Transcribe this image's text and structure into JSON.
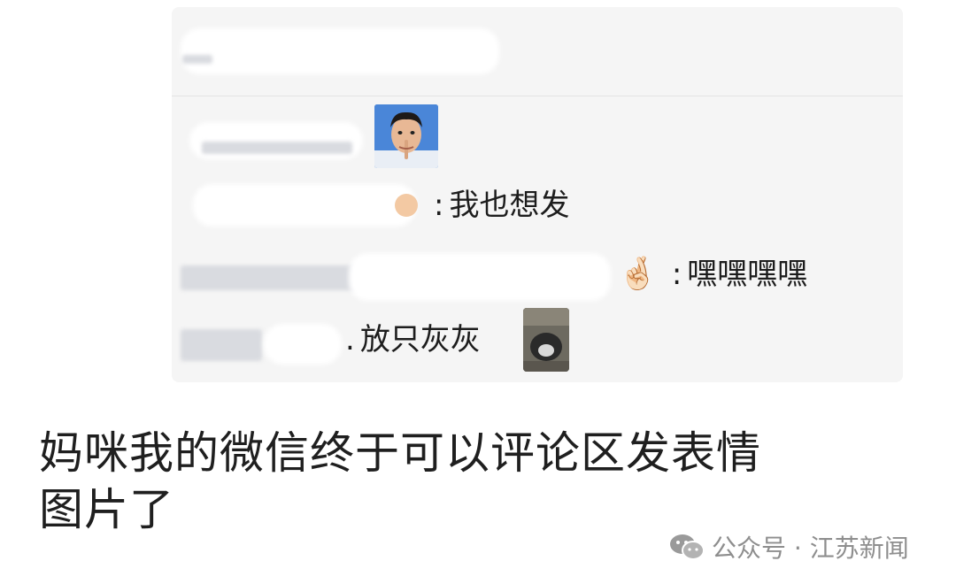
{
  "comments": [
    {
      "separator": "",
      "text": "",
      "sticker": "avatar-sticker"
    },
    {
      "separator": ":",
      "text": "我也想发"
    },
    {
      "separator": ":",
      "text": "嘿嘿嘿嘿",
      "emoji": "🤞🏻"
    },
    {
      "separator": ".",
      "text": "放只灰灰",
      "sticker": "cat-sticker"
    }
  ],
  "headline": {
    "line1": "妈咪我的微信终于可以评论区发表情",
    "line2": "图片了"
  },
  "watermark": {
    "text": "公众号 · 江苏新闻",
    "icon": "wechat-icon"
  },
  "colors": {
    "card": "#f5f5f5",
    "watermark": "#8e8e8e"
  }
}
